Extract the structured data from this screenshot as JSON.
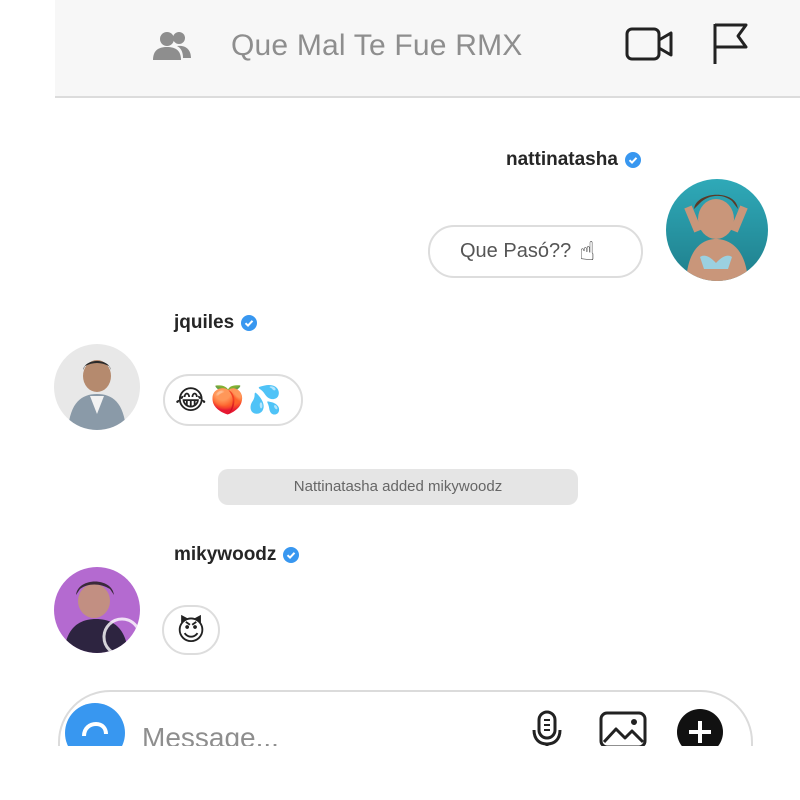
{
  "header": {
    "title": "Que Mal Te Fue RMX",
    "icons": [
      "people-icon",
      "video-call-icon",
      "flag-icon"
    ]
  },
  "messages": [
    {
      "username": "nattinatasha",
      "verified": true,
      "side": "right",
      "text": "Que Pasó??",
      "emoji": "☝"
    },
    {
      "username": "jquiles",
      "verified": true,
      "side": "left",
      "emojis": [
        "😂",
        "🍑",
        "💦"
      ]
    },
    {
      "username": "mikywoodz",
      "verified": true,
      "side": "left",
      "emojis": [
        "😈"
      ]
    }
  ],
  "system_notice": "Nattinatasha added mikywoodz",
  "composer": {
    "placeholder": "Message...",
    "icons": [
      "camera-icon",
      "microphone-icon",
      "gallery-icon",
      "add-icon"
    ]
  },
  "colors": {
    "verified_blue": "#3897f0",
    "camera_blue": "#3897f0",
    "header_bg": "#f7f7f7"
  }
}
